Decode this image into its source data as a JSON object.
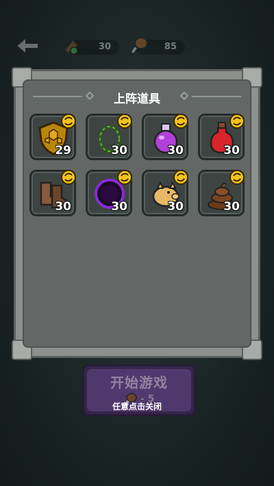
{
  "top_bar": {
    "resource_1": {
      "icon": "meat-icon",
      "value": "30"
    },
    "resource_2": {
      "icon": "drumstick-icon",
      "value": "85"
    }
  },
  "panel": {
    "title": "上阵道具",
    "items": [
      {
        "name": "shield-icon",
        "count": "29"
      },
      {
        "name": "thorn-ring-icon",
        "count": "30"
      },
      {
        "name": "purple-potion-icon",
        "count": "30"
      },
      {
        "name": "red-potion-icon",
        "count": "30"
      },
      {
        "name": "boots-icon",
        "count": "30"
      },
      {
        "name": "dark-orb-icon",
        "count": "30"
      },
      {
        "name": "piggy-bank-icon",
        "count": "30"
      },
      {
        "name": "poop-icon",
        "count": "30"
      }
    ]
  },
  "start_button": {
    "label": "开始游戏",
    "cost": "- 5"
  },
  "close_hint": "任意点击关闭",
  "colors": {
    "accent_gold": "#f2c21a",
    "start_purple": "#5a3b7a",
    "panel_gray": "#636866"
  }
}
